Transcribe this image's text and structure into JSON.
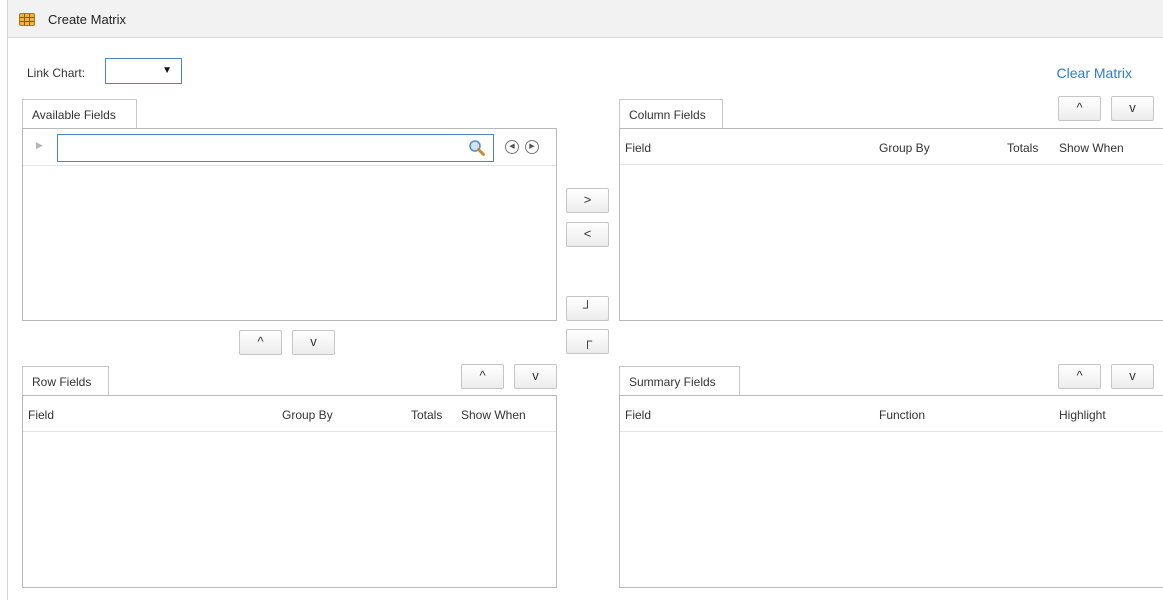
{
  "window": {
    "title": "Create Matrix",
    "icon": "matrix-grid-icon"
  },
  "toolbar": {
    "link_chart_label": "Link Chart:",
    "link_chart_value": "",
    "link_chart_caret": "▼",
    "clear_matrix": "Clear Matrix"
  },
  "available_fields": {
    "tab": "Available Fields",
    "search_value": "",
    "expand_glyph": "▶",
    "prev_glyph": "◀",
    "next_glyph": "▶"
  },
  "transfer": {
    "add": ">",
    "remove": "<",
    "to_row": "┘",
    "to_column": "┌"
  },
  "move": {
    "up": "^",
    "down": "v"
  },
  "column_fields": {
    "tab": "Column Fields",
    "headers": {
      "field": "Field",
      "group_by": "Group By",
      "totals": "Totals",
      "show_when": "Show When"
    }
  },
  "row_fields": {
    "tab": "Row Fields",
    "headers": {
      "field": "Field",
      "group_by": "Group By",
      "totals": "Totals",
      "show_when": "Show When"
    }
  },
  "summary_fields": {
    "tab": "Summary Fields",
    "headers": {
      "field": "Field",
      "function": "Function",
      "highlight": "Highlight"
    }
  },
  "colors": {
    "accent": "#2f7ad1",
    "input_border": "#4a86c5",
    "panel_border": "#b8b8b8",
    "icon_gold": "#e6a51e"
  }
}
